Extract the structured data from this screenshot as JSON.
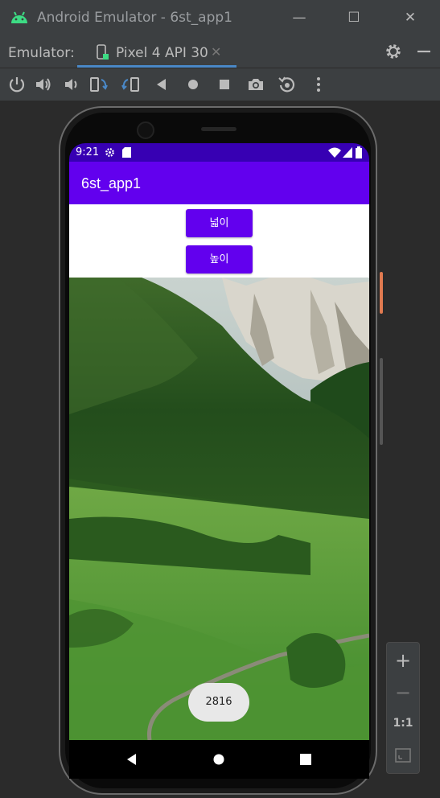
{
  "window": {
    "title": "Android Emulator - 6st_app1",
    "controls": {
      "minimize": "—",
      "maximize": "☐",
      "close": "✕"
    }
  },
  "tabbar": {
    "label": "Emulator:",
    "tab": {
      "name": "Pixel 4 API 30",
      "close": "✕"
    }
  },
  "toolbar": {
    "icons": [
      "power-icon",
      "volume-up-icon",
      "volume-down-icon",
      "rotate-left-icon",
      "rotate-right-icon",
      "back-icon",
      "home-icon",
      "overview-icon",
      "screenshot-icon",
      "snapshot-icon",
      "more-icon"
    ]
  },
  "device": {
    "status": {
      "time": "9:21"
    },
    "app": {
      "title": "6st_app1"
    },
    "buttons": {
      "width_label": "넓이",
      "height_label": "높이"
    },
    "toast": "2816"
  },
  "zoom": {
    "plus": "+",
    "minus": "−",
    "ratio": "1:1"
  },
  "colors": {
    "status": "#3700b3",
    "primary": "#6200ee",
    "ide_bg": "#3c3f41",
    "accent": "#4a88c7"
  }
}
